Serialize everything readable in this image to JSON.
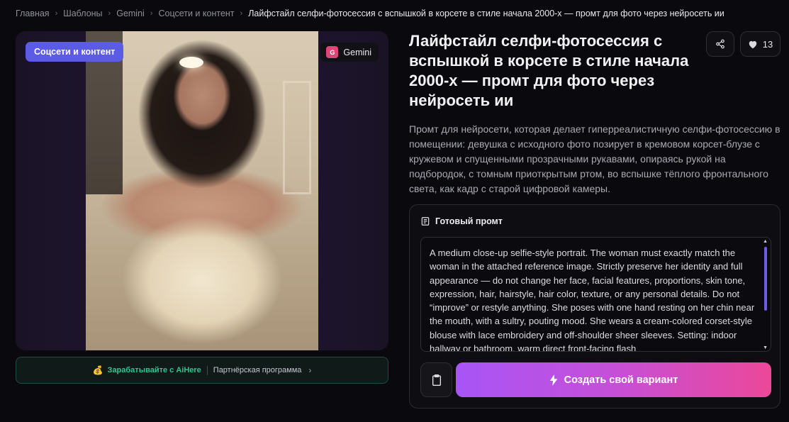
{
  "breadcrumb": {
    "items": [
      "Главная",
      "Шаблоны",
      "Gemini",
      "Соцсети и контент"
    ],
    "current": "Лайфстайл селфи-фотосессия с вспышкой в корсете в стиле начала 2000-х — промт для фото через нейросеть ии"
  },
  "image": {
    "category_badge": "Соцсети и контент",
    "model_badge": "Gemini",
    "model_icon_letter": "G"
  },
  "partner": {
    "earn_label": "Зарабатывайте с AiHere",
    "program_label": "Партнёрская программа"
  },
  "page": {
    "title": "Лайфстайл селфи-фотосессия с вспышкой в корсете в стиле начала 2000-х — промт для фото через нейросеть ии",
    "likes": "13",
    "description": "Промт для нейросети, которая делает гиперреалистичную селфи-фотосессию в помещении: девушка с исходного фото позирует в кремовом корсет-блузе с кружевом и спущенными прозрачными рукавами, опираясь рукой на подбородок, с томным приоткрытым ртом, во вспышке тёплого фронтального света, как кадр с старой цифровой камеры."
  },
  "prompt": {
    "header": "Готовый промт",
    "text": "A medium close-up selfie-style portrait. The woman must exactly match the woman in the attached reference image. Strictly preserve her identity and full appearance — do not change her face, facial features, proportions, skin tone, expression, hair, hairstyle, hair color, texture, or any personal details. Do not “improve” or restyle anything. She poses with one hand resting on her chin near the mouth, with a sultry, pouting mood. She wears a cream-colored corset-style blouse with lace embroidery and off-shoulder sheer sleeves. Setting: indoor hallway or bathroom, warm direct front-facing flash",
    "create_label": "Создать свой вариант"
  },
  "colors": {
    "accent": "#5b5be6",
    "gradient_start": "#a855f7",
    "gradient_end": "#ec4899",
    "earn_green": "#34c38f",
    "scroll_thumb": "#6e5be8"
  },
  "icons": {
    "share": "share-icon",
    "like": "heart-icon",
    "prompt": "document-icon",
    "copy": "clipboard-icon",
    "create": "lightning-icon",
    "partner": "coin-icon"
  }
}
